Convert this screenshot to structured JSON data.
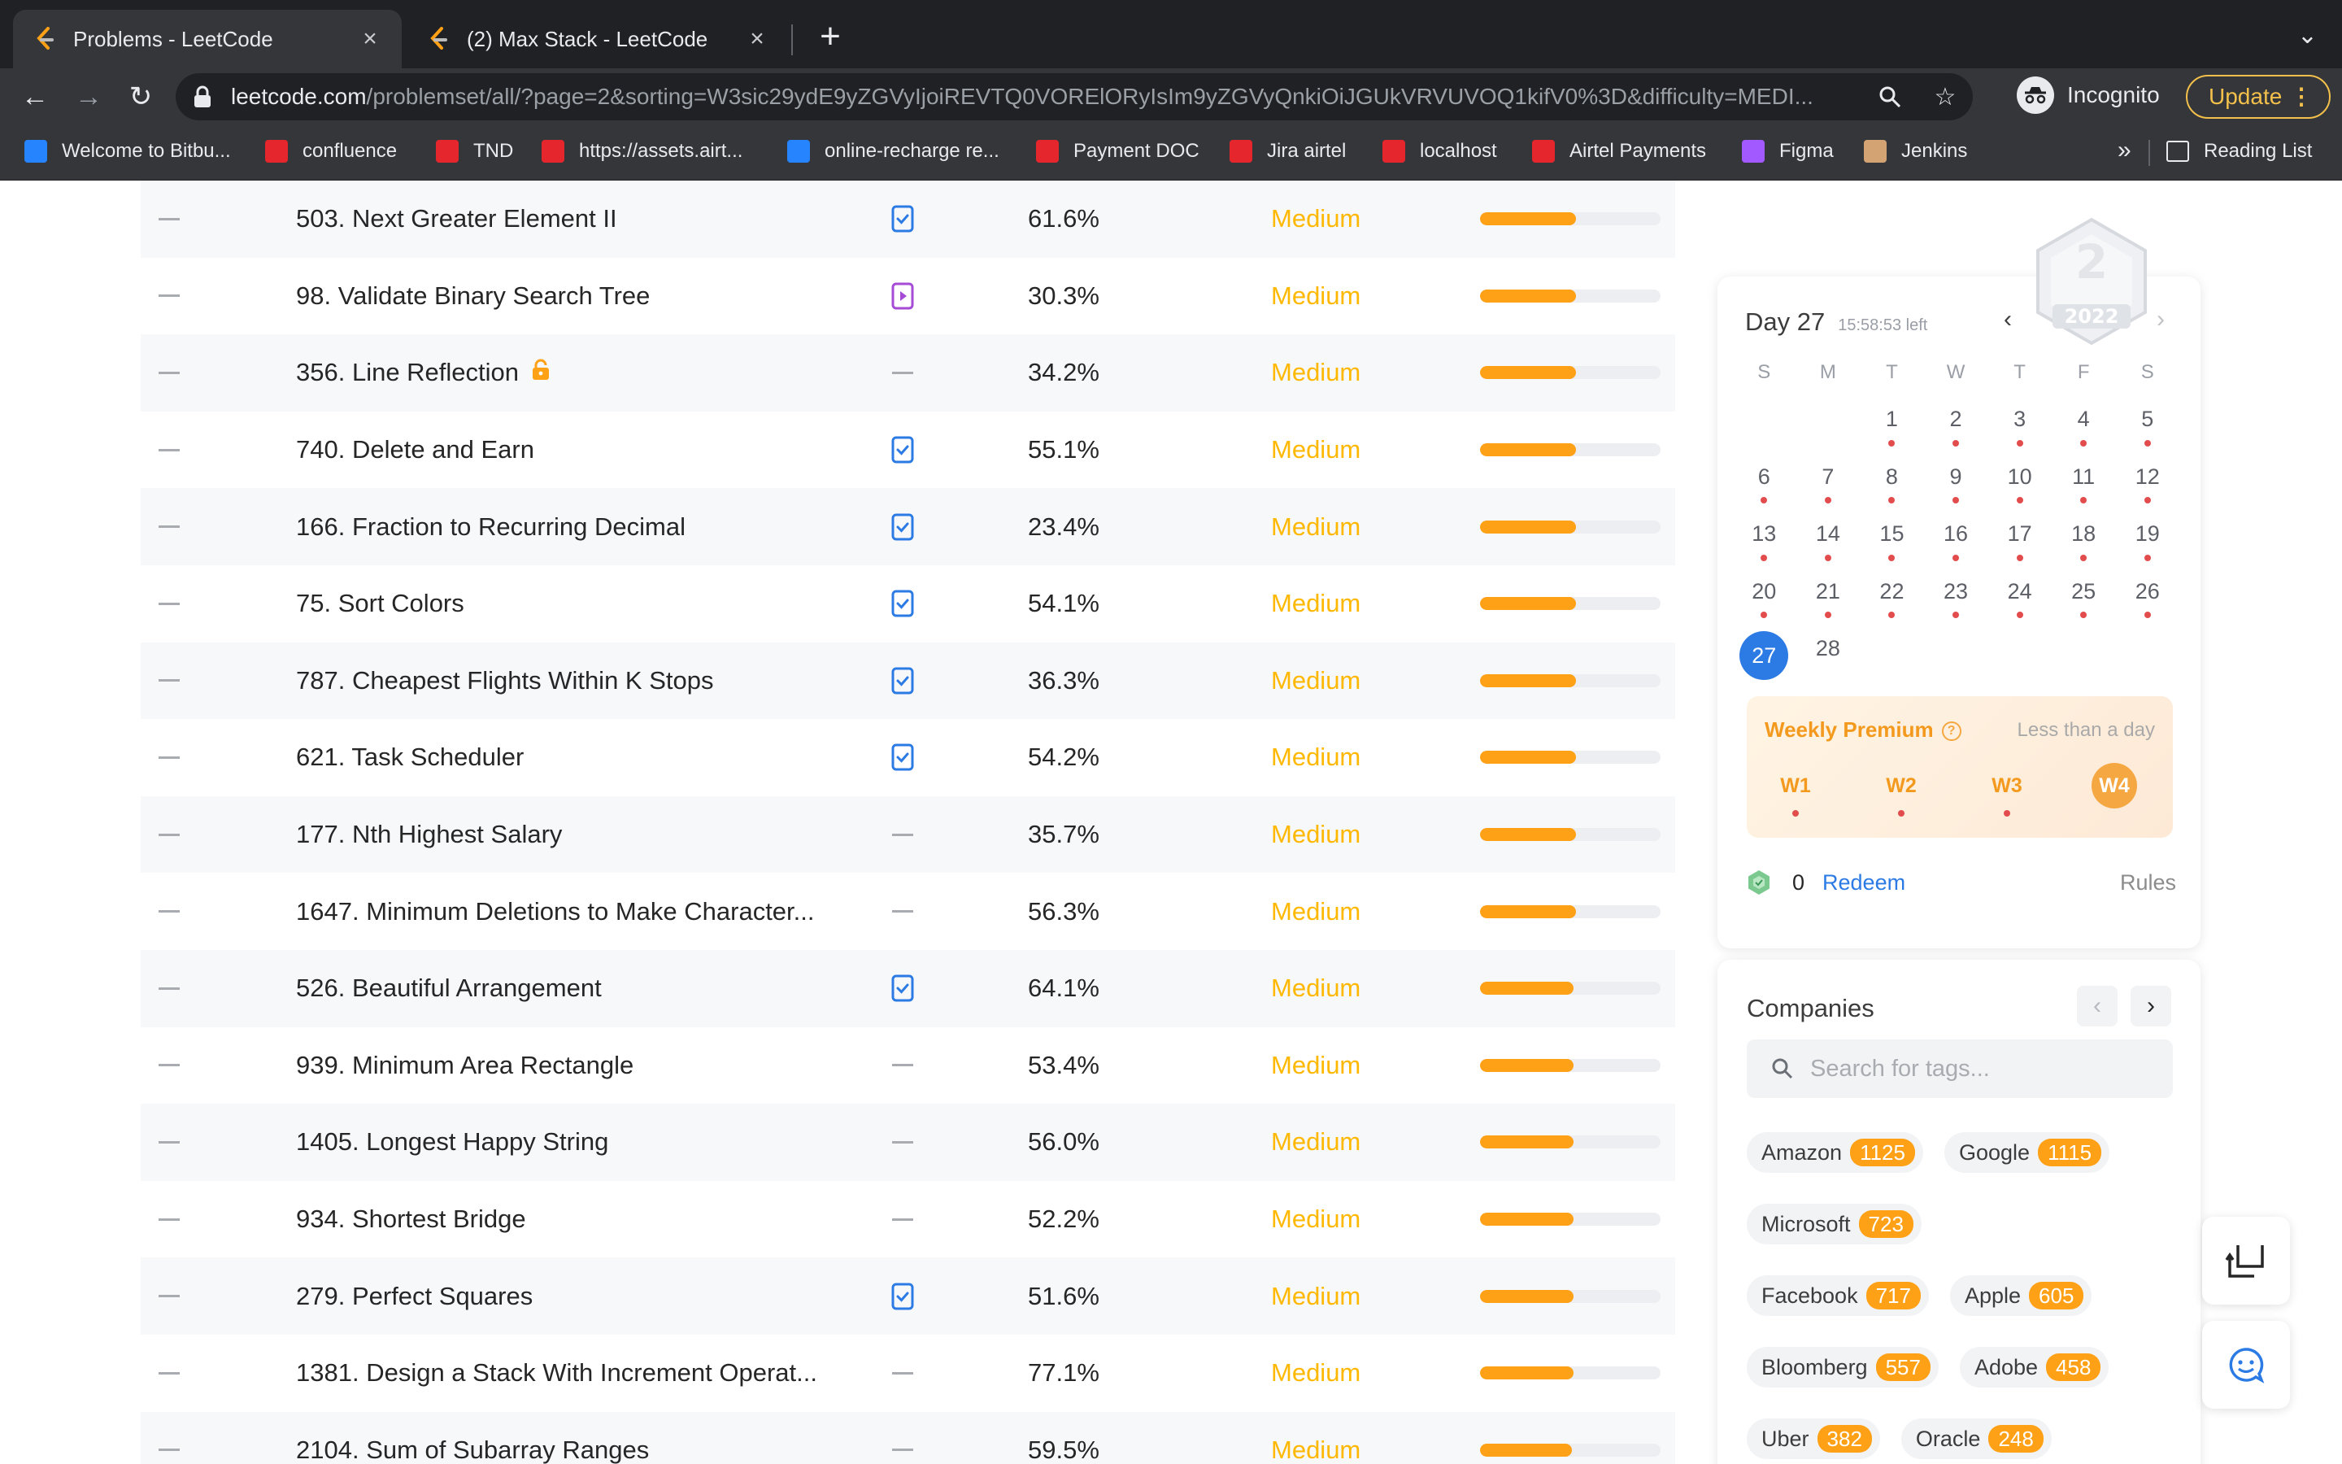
{
  "browser": {
    "tabs": [
      {
        "title": "Problems - LeetCode",
        "active": true
      },
      {
        "title": "(2) Max Stack - LeetCode",
        "active": false
      }
    ],
    "new_tab_icon": "plus-icon",
    "url_host": "leetcode.com",
    "url_path": "/problemset/all/?page=2&sorting=W3sic29ydE9yZGVyIjoiREVTQ0VORElORyIsIm9yZGVyQnkiOiJGUkVRVUVOQ1kifV0%3D&difficulty=MEDI...",
    "incognito_label": "Incognito",
    "update_label": "Update",
    "bookmarks": [
      {
        "label": "Welcome to Bitbu...",
        "color": "#2684ff"
      },
      {
        "label": "confluence",
        "color": "#e6262d"
      },
      {
        "label": "TND",
        "color": "#e6262d"
      },
      {
        "label": "https://assets.airt...",
        "color": "#e6262d"
      },
      {
        "label": "online-recharge re...",
        "color": "#2684ff"
      },
      {
        "label": "Payment DOC",
        "color": "#e6262d"
      },
      {
        "label": "Jira airtel",
        "color": "#e6262d"
      },
      {
        "label": "localhost",
        "color": "#e6262d"
      },
      {
        "label": "Airtel Payments",
        "color": "#e6262d"
      },
      {
        "label": "Figma",
        "color": "#a259ff"
      },
      {
        "label": "Jenkins",
        "color": "#d4a373"
      }
    ],
    "bookmarks_more": "»",
    "reading_list_label": "Reading List"
  },
  "problems": [
    {
      "title": "503. Next Greater Element II",
      "solution": "article",
      "acceptance": "61.6%",
      "difficulty": "Medium",
      "frequency": 0.53,
      "locked": false
    },
    {
      "title": "98. Validate Binary Search Tree",
      "solution": "video",
      "acceptance": "30.3%",
      "difficulty": "Medium",
      "frequency": 0.53,
      "locked": false
    },
    {
      "title": "356. Line Reflection",
      "solution": "none",
      "acceptance": "34.2%",
      "difficulty": "Medium",
      "frequency": 0.53,
      "locked": true
    },
    {
      "title": "740. Delete and Earn",
      "solution": "article",
      "acceptance": "55.1%",
      "difficulty": "Medium",
      "frequency": 0.53,
      "locked": false
    },
    {
      "title": "166. Fraction to Recurring Decimal",
      "solution": "article",
      "acceptance": "23.4%",
      "difficulty": "Medium",
      "frequency": 0.53,
      "locked": false
    },
    {
      "title": "75. Sort Colors",
      "solution": "article",
      "acceptance": "54.1%",
      "difficulty": "Medium",
      "frequency": 0.53,
      "locked": false
    },
    {
      "title": "787. Cheapest Flights Within K Stops",
      "solution": "article",
      "acceptance": "36.3%",
      "difficulty": "Medium",
      "frequency": 0.53,
      "locked": false
    },
    {
      "title": "621. Task Scheduler",
      "solution": "article",
      "acceptance": "54.2%",
      "difficulty": "Medium",
      "frequency": 0.53,
      "locked": false
    },
    {
      "title": "177. Nth Highest Salary",
      "solution": "none",
      "acceptance": "35.7%",
      "difficulty": "Medium",
      "frequency": 0.53,
      "locked": false
    },
    {
      "title": "1647. Minimum Deletions to Make Character...",
      "solution": "none",
      "acceptance": "56.3%",
      "difficulty": "Medium",
      "frequency": 0.53,
      "locked": false
    },
    {
      "title": "526. Beautiful Arrangement",
      "solution": "article",
      "acceptance": "64.1%",
      "difficulty": "Medium",
      "frequency": 0.52,
      "locked": false
    },
    {
      "title": "939. Minimum Area Rectangle",
      "solution": "none",
      "acceptance": "53.4%",
      "difficulty": "Medium",
      "frequency": 0.52,
      "locked": false
    },
    {
      "title": "1405. Longest Happy String",
      "solution": "none",
      "acceptance": "56.0%",
      "difficulty": "Medium",
      "frequency": 0.52,
      "locked": false
    },
    {
      "title": "934. Shortest Bridge",
      "solution": "none",
      "acceptance": "52.2%",
      "difficulty": "Medium",
      "frequency": 0.52,
      "locked": false
    },
    {
      "title": "279. Perfect Squares",
      "solution": "article",
      "acceptance": "51.6%",
      "difficulty": "Medium",
      "frequency": 0.52,
      "locked": false
    },
    {
      "title": "1381. Design a Stack With Increment Operat...",
      "solution": "none",
      "acceptance": "77.1%",
      "difficulty": "Medium",
      "frequency": 0.52,
      "locked": false
    },
    {
      "title": "2104. Sum of Subarray Ranges",
      "solution": "none",
      "acceptance": "59.5%",
      "difficulty": "Medium",
      "frequency": 0.51,
      "locked": false
    }
  ],
  "calendar": {
    "day_label": "Day 27",
    "time_left": "15:58:53 left",
    "badge_number": "2",
    "badge_year": "2022",
    "weekdays": [
      "S",
      "M",
      "T",
      "W",
      "T",
      "F",
      "S"
    ],
    "weeks": [
      [
        "",
        "",
        "1",
        "2",
        "3",
        "4",
        "5"
      ],
      [
        "6",
        "7",
        "8",
        "9",
        "10",
        "11",
        "12"
      ],
      [
        "13",
        "14",
        "15",
        "16",
        "17",
        "18",
        "19"
      ],
      [
        "20",
        "21",
        "22",
        "23",
        "24",
        "25",
        "26"
      ],
      [
        "27",
        "28",
        "",
        "",
        "",
        "",
        ""
      ]
    ],
    "today": "27",
    "weekly_premium": {
      "title": "Weekly Premium",
      "time_left": "Less than a day",
      "weeks": [
        "W1",
        "W2",
        "W3",
        "W4"
      ],
      "current_week": "W4"
    },
    "coins": "0",
    "redeem_label": "Redeem",
    "rules_label": "Rules"
  },
  "companies": {
    "title": "Companies",
    "search_placeholder": "Search for tags...",
    "tags": [
      [
        {
          "name": "Amazon",
          "count": "1125"
        },
        {
          "name": "Google",
          "count": "1115"
        }
      ],
      [
        {
          "name": "Microsoft",
          "count": "723"
        }
      ],
      [
        {
          "name": "Facebook",
          "count": "717"
        },
        {
          "name": "Apple",
          "count": "605"
        }
      ],
      [
        {
          "name": "Bloomberg",
          "count": "557"
        },
        {
          "name": "Adobe",
          "count": "458"
        }
      ],
      [
        {
          "name": "Uber",
          "count": "382"
        },
        {
          "name": "Oracle",
          "count": "248"
        }
      ]
    ]
  }
}
